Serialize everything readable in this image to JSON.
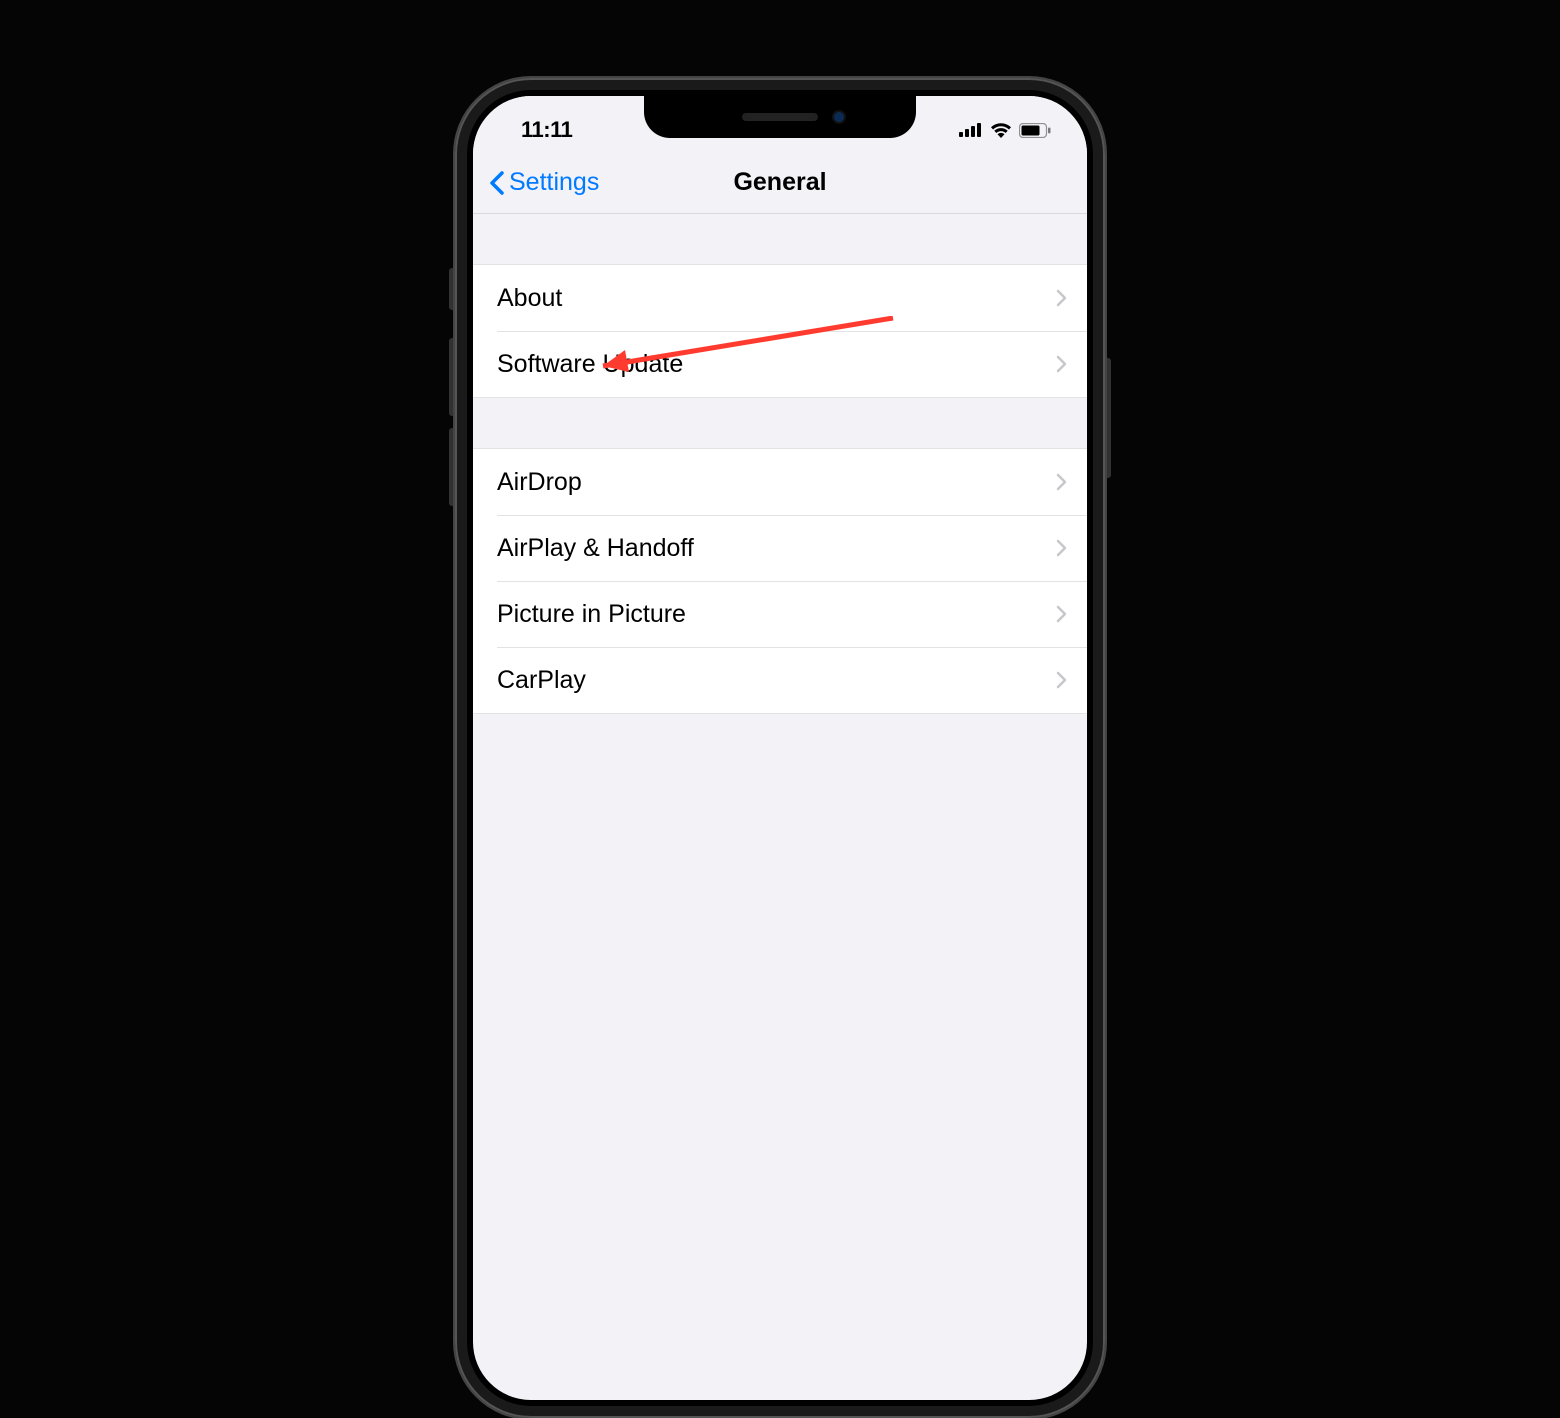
{
  "status": {
    "time": "11:11"
  },
  "nav": {
    "back_label": "Settings",
    "title": "General"
  },
  "group1": [
    {
      "label": "About"
    },
    {
      "label": "Software Update"
    }
  ],
  "group2": [
    {
      "label": "AirDrop"
    },
    {
      "label": "AirPlay & Handoff"
    },
    {
      "label": "Picture in Picture"
    },
    {
      "label": "CarPlay"
    }
  ]
}
